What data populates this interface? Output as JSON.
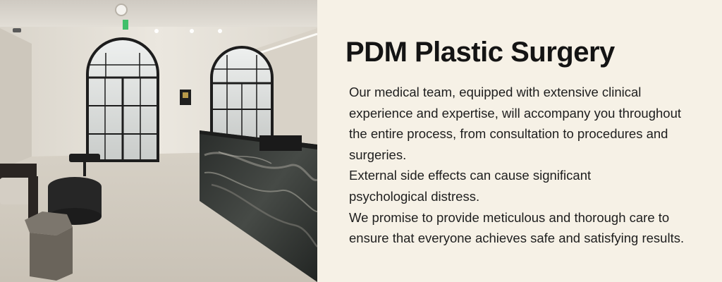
{
  "banner": {
    "title": "PDM Plastic Surgery",
    "lines": [
      "Our medical team, equipped with extensive clinical",
      "experience and expertise, will accompany you throughout",
      "the entire process, from consultation to procedures and",
      "surgeries.",
      "External side effects can cause significant",
      "psychological distress.",
      "We promise to provide meticulous and thorough care to",
      "ensure that everyone achieves safe and satisfying results."
    ]
  },
  "photo": {
    "subject": "clinic-lobby-photo"
  },
  "colors": {
    "background": "#f6f1e6",
    "title": "#141414",
    "body": "#1e1e1e",
    "marble": "#2e312f",
    "exit_sign": "#3fbf6a"
  }
}
